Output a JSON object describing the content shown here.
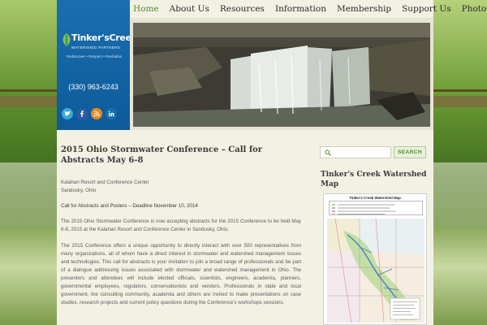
{
  "nav": {
    "items": [
      "Home",
      "About Us",
      "Resources",
      "Information",
      "Membership",
      "Support Us",
      "Photos"
    ],
    "active": "Home"
  },
  "brand": {
    "title": "Tinker'sCreek",
    "subtitle": "WATERSHED PARTNERS",
    "tagline": "Rediscover • Respect • Revitalize",
    "phone": "(330) 963-6243",
    "primary_color": "#0d5a99",
    "accent_color": "#4b8d2a"
  },
  "social": [
    {
      "icon": "twitter-icon",
      "color": "#3aa7d8"
    },
    {
      "icon": "facebook-icon",
      "color": "#2d5da0"
    },
    {
      "icon": "rss-icon",
      "color": "#e98a1c"
    },
    {
      "icon": "linkedin-icon",
      "color": "#1a6fa8"
    }
  ],
  "post": {
    "title": "2015 Ohio Stormwater Conference – Call for Abstracts May 6-8",
    "venue_line1": "Kalahari Resort and Conference Center",
    "venue_line2": "Sandusky, Ohio",
    "deadline": "Call for Abstracts and Posters – Deadline November 10, 2014",
    "para1": "The 2015 Ohio Stormwater Conference is now accepting abstracts for the 2015 Conference to be held May 6-8, 2015 at the Kalahari Resort and Conference Center in Sandusky, Ohio.",
    "para2": "The 2015 Conference offers a unique opportunity to directly interact with over 500 representatives from many organizations, all of whom have a direct interest in stormwater and watershed management issues and technologies. This call for abstracts is your invitation to join a broad range of professionals and be part of a dialogue addressing issues associated with stormwater and watershed management in Ohio. The presenters and attendees will include elected officials, scientists, engineers, academia, planners, governmental employees, regulators, conservationists and vendors. Professionals in state and local government, the consulting community, academia and others are invited to make presentations on case studies, research projects and current policy questions during the Conference's workshops sessions."
  },
  "sidebar": {
    "search_placeholder": "",
    "search_button": "SEARCH",
    "widget_title": "Tinker's Creek Watershed Map",
    "map_heading": "Tinker's Creek Watershed Map"
  }
}
